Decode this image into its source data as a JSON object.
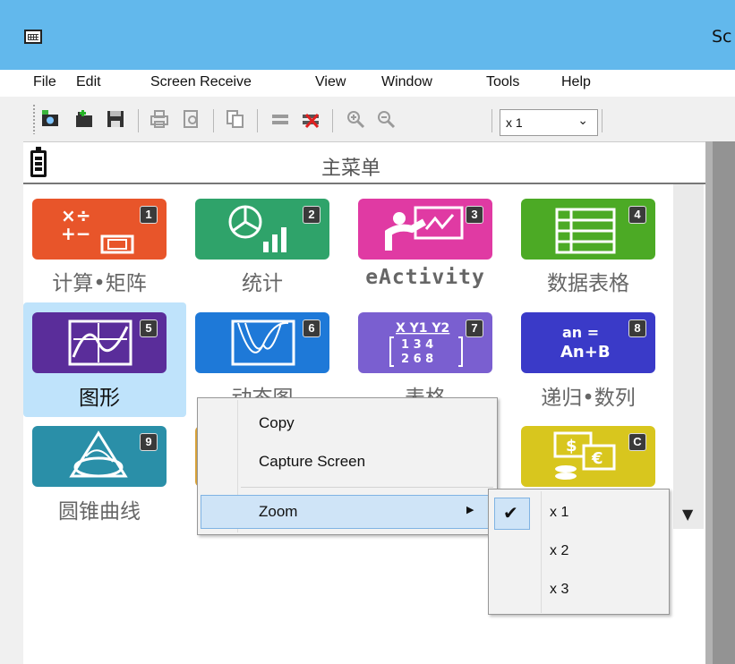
{
  "window": {
    "title": "Sc"
  },
  "menubar": {
    "items": [
      {
        "label": "File",
        "name": "menu-file"
      },
      {
        "label": "Edit",
        "name": "menu-edit"
      },
      {
        "label": "Screen Receive",
        "name": "menu-screen-receive"
      },
      {
        "label": "View",
        "name": "menu-view"
      },
      {
        "label": "Window",
        "name": "menu-window"
      },
      {
        "label": "Tools",
        "name": "menu-tools"
      },
      {
        "label": "Help",
        "name": "menu-help"
      }
    ]
  },
  "toolbar": {
    "icons": [
      "camera-capture-icon",
      "new-folder-icon",
      "save-icon",
      "print-icon",
      "print-preview-icon",
      "copy-icon",
      "connect-icon",
      "disconnect-icon",
      "zoom-in-icon",
      "zoom-out-icon"
    ],
    "zoom_value": "x 1"
  },
  "screen": {
    "title": "主菜单",
    "tiles": [
      {
        "number": "1",
        "label": "计算•矩阵",
        "name": "tile-run-matrix",
        "icon": "calculator-matrix-icon",
        "color": "#e8552a"
      },
      {
        "number": "2",
        "label": "统计",
        "name": "tile-statistics",
        "icon": "statistics-chart-icon",
        "color": "#2fa36a"
      },
      {
        "number": "3",
        "label": "eActivity",
        "name": "tile-eactivity",
        "icon": "teacher-board-icon",
        "color": "#e03aa3"
      },
      {
        "number": "4",
        "label": "数据表格",
        "name": "tile-spreadsheet",
        "icon": "spreadsheet-icon",
        "color": "#4caa25"
      },
      {
        "number": "5",
        "label": "图形",
        "name": "tile-graph",
        "icon": "graph-icon",
        "color": "#5a2d9a"
      },
      {
        "number": "6",
        "label": "动态图",
        "name": "tile-dyna-graph",
        "icon": "dyna-graph-icon",
        "color": "#1e79d8"
      },
      {
        "number": "7",
        "label": "表格",
        "name": "tile-table",
        "icon": "table-icon",
        "color": "#7a5fd0",
        "icon_text": [
          "X Y1 Y2",
          "1 3 4",
          "2 6 8"
        ]
      },
      {
        "number": "8",
        "label": "递归•数列",
        "name": "tile-recursion",
        "icon": "recursion-icon",
        "color": "#3a3ac8",
        "icon_text": [
          "an =",
          "An+B"
        ]
      },
      {
        "number": "9",
        "label": "圆锥曲线",
        "name": "tile-conic",
        "icon": "conic-icon",
        "color": "#2a8fa8"
      },
      {
        "number": "",
        "label": "",
        "name": "tile-hidden-a",
        "icon": "",
        "color": "#d8a23a"
      },
      {
        "number": "",
        "label": "",
        "name": "tile-hidden-b",
        "icon": "",
        "color": "#8a7a30"
      },
      {
        "number": "C",
        "label": "",
        "name": "tile-financial",
        "icon": "finance-icon",
        "color": "#d8c61e",
        "icon_text": [
          "$",
          "€"
        ]
      }
    ]
  },
  "context_menu": {
    "items": [
      {
        "label": "Copy"
      },
      {
        "label": "Capture Screen"
      },
      {
        "label": "Zoom"
      }
    ]
  },
  "zoom_submenu": {
    "items": [
      {
        "label": "x 1",
        "checked": true
      },
      {
        "label": "x 2",
        "checked": false
      },
      {
        "label": "x 3",
        "checked": false
      }
    ]
  }
}
